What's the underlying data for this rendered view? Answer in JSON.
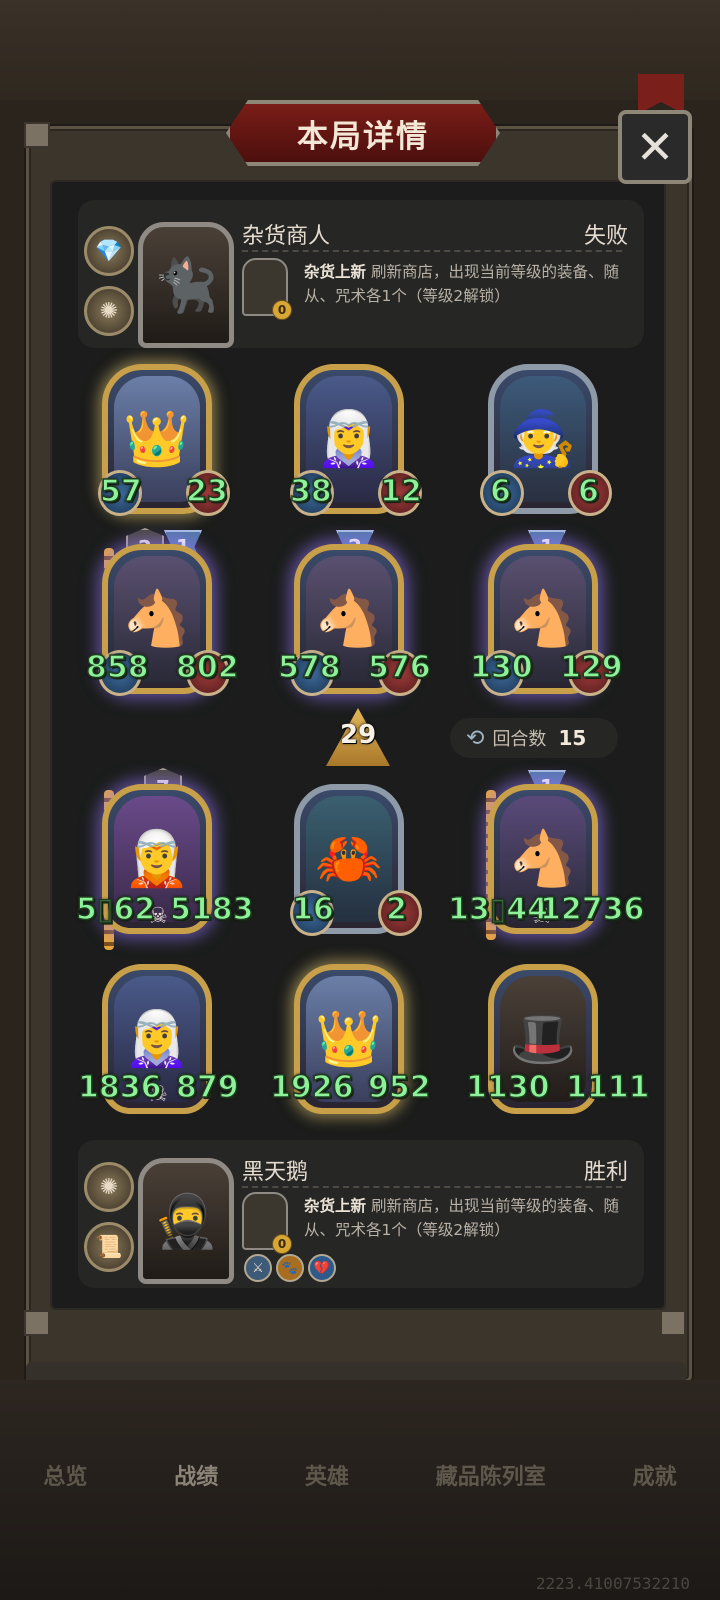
{
  "title": "本局详情",
  "close_glyph": "✕",
  "top_player": {
    "name": "杂货商人",
    "result": "失败",
    "skill_name": "杂货上新",
    "skill_desc": "刷新商店，出现当前等级的装备、随从、咒术各1个（等级2解锁）",
    "skill_cost": "0"
  },
  "bottom_player": {
    "name": "黑天鹅",
    "result": "胜利",
    "skill_name": "杂货上新",
    "skill_desc": "刷新商店，出现当前等级的装备、随从、咒术各1个（等级2解锁）",
    "skill_cost": "0"
  },
  "enemy_board": [
    {
      "atk": "57",
      "hp": "23",
      "tier": "",
      "level": ""
    },
    {
      "atk": "38",
      "hp": "12",
      "tier": "",
      "level": ""
    },
    {
      "atk": "6",
      "hp": "6",
      "tier": "",
      "level": ""
    },
    {
      "atk": "858",
      "hp": "802",
      "tier": "1",
      "level": "2"
    },
    {
      "atk": "578",
      "hp": "576",
      "tier": "2",
      "level": ""
    },
    {
      "atk": "130",
      "hp": "129",
      "tier": "1",
      "level": ""
    }
  ],
  "round_arrow_value": "29",
  "round_label": "回合数",
  "round_value": "15",
  "player_board": [
    {
      "atk": "5▯62",
      "hp": "5183",
      "tier": "",
      "level": "7"
    },
    {
      "atk": "16",
      "hp": "2",
      "tier": "",
      "level": ""
    },
    {
      "atk": "13▯44",
      "hp": "12736",
      "tier": "1",
      "level": ""
    },
    {
      "atk": "1836",
      "hp": "879",
      "tier": "",
      "level": ""
    },
    {
      "atk": "1926",
      "hp": "952",
      "tier": "",
      "level": ""
    },
    {
      "atk": "1130",
      "hp": "1111",
      "tier": "",
      "level": ""
    }
  ],
  "nav": [
    "总览",
    "战绩",
    "英雄",
    "藏品陈列室",
    "成就"
  ],
  "nav_active": "战绩",
  "footer_id": "2223.41007532210"
}
